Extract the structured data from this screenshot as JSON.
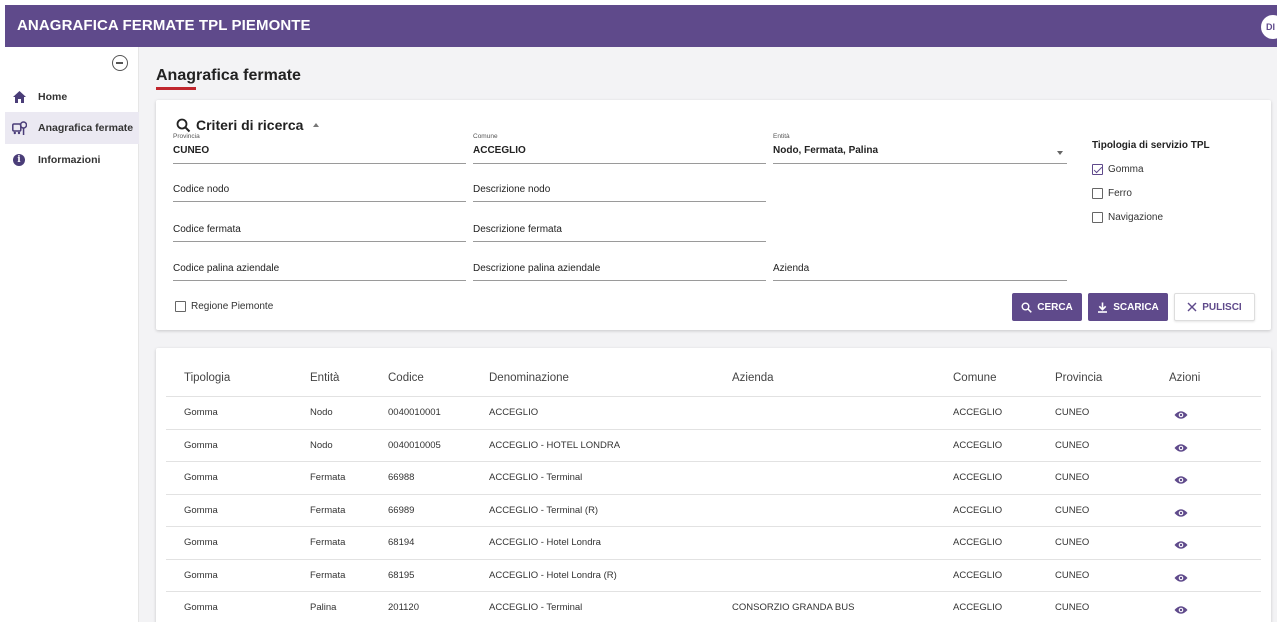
{
  "app": {
    "title": "ANAGRAFICA FERMATE TPL PIEMONTE",
    "user_initials": "DI"
  },
  "sidebar": {
    "items": [
      {
        "label": "Home",
        "icon": "home-icon"
      },
      {
        "label": "Anagrafica fermate",
        "icon": "bus-stop-icon",
        "active": true
      },
      {
        "label": "Informazioni",
        "icon": "info-icon"
      }
    ]
  },
  "page": {
    "title": "Anagrafica fermate"
  },
  "search": {
    "header": "Criteri di ricerca",
    "provincia": {
      "label": "Provincia",
      "value": "CUNEO"
    },
    "comune": {
      "label": "Comune",
      "value": "ACCEGLIO"
    },
    "entita": {
      "label": "Entità",
      "value": "Nodo, Fermata, Palina"
    },
    "codice_nodo": {
      "placeholder": "Codice nodo"
    },
    "descrizione_nodo": {
      "placeholder": "Descrizione nodo"
    },
    "codice_fermata": {
      "placeholder": "Codice fermata"
    },
    "descrizione_fermata": {
      "placeholder": "Descrizione fermata"
    },
    "codice_palina": {
      "placeholder": "Codice palina aziendale"
    },
    "descrizione_palina": {
      "placeholder": "Descrizione palina aziendale"
    },
    "azienda": {
      "placeholder": "Azienda"
    },
    "regione_piemonte": {
      "label": "Regione Piemonte",
      "checked": false
    },
    "tipologia": {
      "title": "Tipologia di servizio TPL",
      "options": [
        {
          "label": "Gomma",
          "checked": true
        },
        {
          "label": "Ferro",
          "checked": false
        },
        {
          "label": "Navigazione",
          "checked": false
        }
      ]
    },
    "buttons": {
      "cerca": "CERCA",
      "scarica": "SCARICA",
      "pulisci": "PULISCI"
    }
  },
  "results": {
    "columns": [
      "Tipologia",
      "Entità",
      "Codice",
      "Denominazione",
      "Azienda",
      "Comune",
      "Provincia",
      "Azioni"
    ],
    "rows": [
      {
        "tipologia": "Gomma",
        "entita": "Nodo",
        "codice": "0040010001",
        "denominazione": "ACCEGLIO",
        "azienda": "",
        "comune": "ACCEGLIO",
        "provincia": "CUNEO"
      },
      {
        "tipologia": "Gomma",
        "entita": "Nodo",
        "codice": "0040010005",
        "denominazione": "ACCEGLIO - HOTEL LONDRA",
        "azienda": "",
        "comune": "ACCEGLIO",
        "provincia": "CUNEO"
      },
      {
        "tipologia": "Gomma",
        "entita": "Fermata",
        "codice": "66988",
        "denominazione": "ACCEGLIO - Terminal",
        "azienda": "",
        "comune": "ACCEGLIO",
        "provincia": "CUNEO"
      },
      {
        "tipologia": "Gomma",
        "entita": "Fermata",
        "codice": "66989",
        "denominazione": "ACCEGLIO - Terminal (R)",
        "azienda": "",
        "comune": "ACCEGLIO",
        "provincia": "CUNEO"
      },
      {
        "tipologia": "Gomma",
        "entita": "Fermata",
        "codice": "68194",
        "denominazione": "ACCEGLIO - Hotel Londra",
        "azienda": "",
        "comune": "ACCEGLIO",
        "provincia": "CUNEO"
      },
      {
        "tipologia": "Gomma",
        "entita": "Fermata",
        "codice": "68195",
        "denominazione": "ACCEGLIO - Hotel Londra (R)",
        "azienda": "",
        "comune": "ACCEGLIO",
        "provincia": "CUNEO"
      },
      {
        "tipologia": "Gomma",
        "entita": "Palina",
        "codice": "201120",
        "denominazione": "ACCEGLIO - Terminal",
        "azienda": "CONSORZIO GRANDA BUS",
        "comune": "ACCEGLIO",
        "provincia": "CUNEO"
      }
    ]
  },
  "colors": {
    "brand": "#5f4a8b",
    "accent_underline": "#c0262d"
  }
}
